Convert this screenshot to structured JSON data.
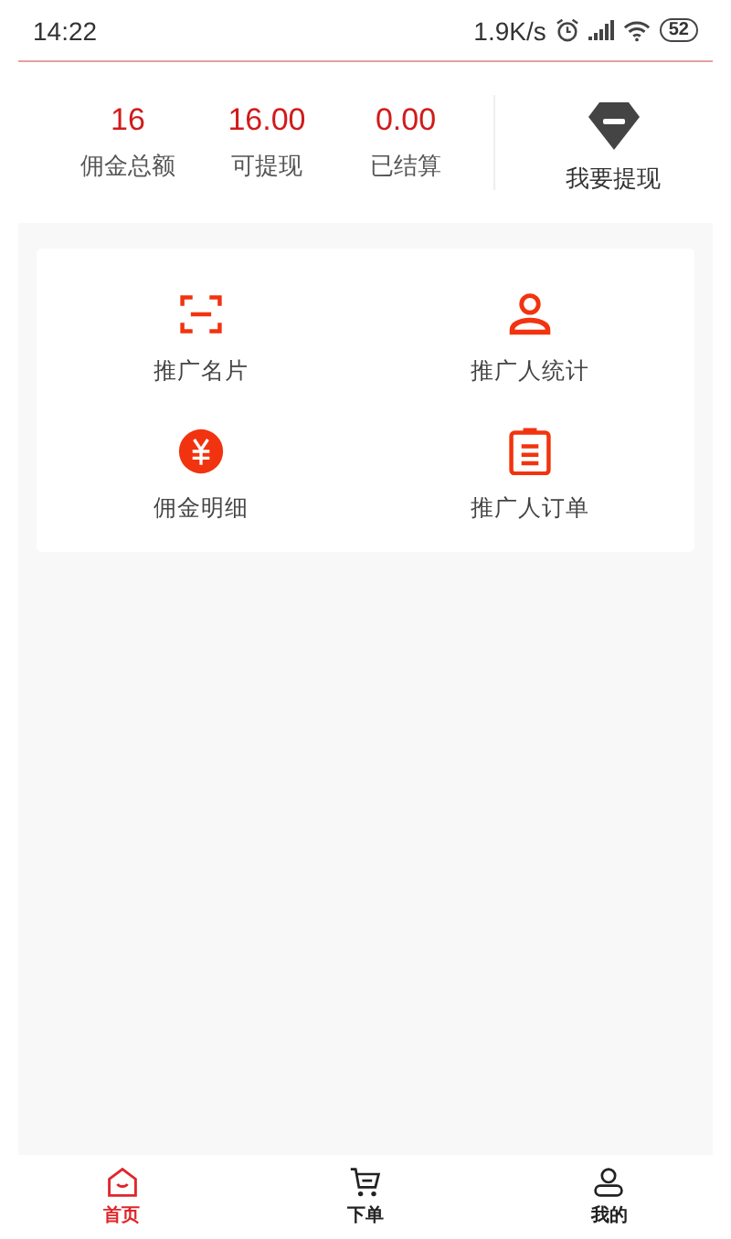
{
  "status_bar": {
    "time": "14:22",
    "speed": "1.9K/s",
    "battery": "52"
  },
  "stats": [
    {
      "value": "16",
      "label": "佣金总额"
    },
    {
      "value": "16.00",
      "label": "可提现"
    },
    {
      "value": "0.00",
      "label": "已结算"
    }
  ],
  "withdraw": {
    "label": "我要提现"
  },
  "menu": [
    {
      "kind": "card",
      "label": "推广名片"
    },
    {
      "kind": "user",
      "label": "推广人统计"
    },
    {
      "kind": "yen",
      "label": "佣金明细"
    },
    {
      "kind": "clipboard",
      "label": "推广人订单"
    }
  ],
  "tabs": [
    {
      "kind": "home",
      "label": "首页",
      "selected": true
    },
    {
      "kind": "cart",
      "label": "下单",
      "selected": false
    },
    {
      "kind": "user",
      "label": "我的",
      "selected": false
    }
  ]
}
